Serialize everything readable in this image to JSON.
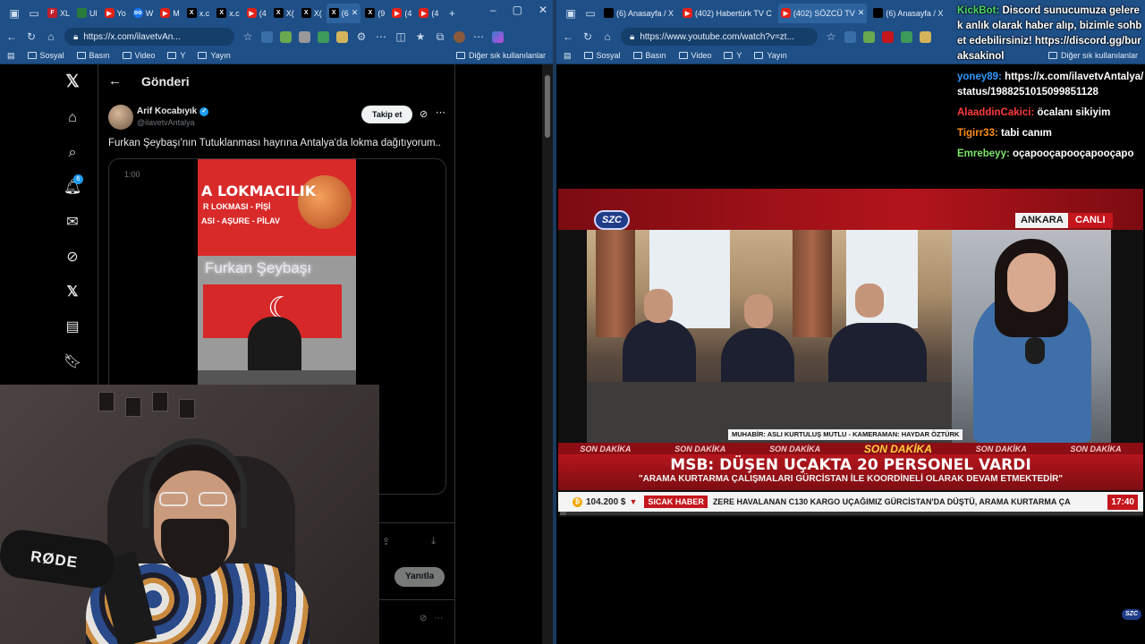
{
  "left_browser": {
    "tabs": [
      {
        "label": "XL",
        "fav": "F",
        "type": "f"
      },
      {
        "label": "Ul",
        "fav": "",
        "type": "g"
      },
      {
        "label": "Yo",
        "fav": "",
        "type": "yt"
      },
      {
        "label": "W",
        "fav": "oo",
        "type": "b"
      },
      {
        "label": "M",
        "fav": "",
        "type": "yt"
      },
      {
        "label": "x.c",
        "fav": "X",
        "type": "x"
      },
      {
        "label": "x.c",
        "fav": "X",
        "type": "x"
      },
      {
        "label": "(4",
        "fav": "",
        "type": "yt"
      },
      {
        "label": "X(",
        "fav": "X",
        "type": "x"
      },
      {
        "label": "X(",
        "fav": "X",
        "type": "x"
      },
      {
        "label": "(6",
        "fav": "X",
        "type": "x",
        "active": true
      },
      {
        "label": "(9",
        "fav": "X",
        "type": "x"
      },
      {
        "label": "(4",
        "fav": "",
        "type": "yt"
      },
      {
        "label": "(4",
        "fav": "",
        "type": "yt"
      }
    ],
    "url": "https://x.com/ilavetvAn...",
    "bookmarks": [
      "Sosyal",
      "Basın",
      "Video",
      "Y",
      "Yayın"
    ],
    "other_bookmarks": "Diğer sık kullanılanlar"
  },
  "x_page": {
    "header_title": "Gönderi",
    "author_name": "Arif Kocabıyık",
    "author_handle": "@ilavetvAntalya",
    "follow_label": "Takip et",
    "tweet_text": "Furkan Şeybaşı'nın Tutuklanması hayrına Antalya'da lokma dağıtıyorum..",
    "video_time": "1:00",
    "sign_line1": "A LOKMACILIK",
    "sign_line2": "R LOKMASI - PİŞİ",
    "sign_line3": "ASI - AŞURE - PİLAV",
    "neon_text": "Furkan Şeybaşı",
    "reply_label": "Yanıtla",
    "notification_count": "6"
  },
  "right_browser": {
    "tabs": [
      {
        "label": "(6) Anasayfa / X",
        "type": "x"
      },
      {
        "label": "(402) Habertürk TV C",
        "type": "yt"
      },
      {
        "label": "(402) SÖZCÜ TV",
        "type": "yt",
        "active": true
      },
      {
        "label": "(6) Anasayfa / X",
        "type": "x"
      }
    ],
    "url": "https://www.youtube.com/watch?v=zt...",
    "bookmarks": [
      "Sosyal",
      "Basın",
      "Video",
      "Y",
      "Yayın"
    ],
    "other_bookmarks": "Diğer sık kullanılanlar"
  },
  "broadcast": {
    "channel_logo": "SZC",
    "location": "ANKARA",
    "live": "CANLI",
    "credit": "MUHABİR: ASLI KURTULUŞ MUTLU - KAMERAMAN: HAYDAR ÖZTÜRK",
    "breaking": "SON DAKİKA",
    "headline": "MSB: DÜŞEN UÇAKTA 20 PERSONEL VARDI",
    "subheadline": "\"ARAMA KURTARMA ÇALIŞMALARI GÜRCİSTAN İLE KOORDİNELİ OLARAK DEVAM ETMEKTEDİR\"",
    "btc_value": "104.200 $",
    "ticker_tag": "SICAK HABER",
    "ticker_text": "ZERE HAVALANAN C130 KARGO UÇAĞIMIZ GÜRCİSTAN'DA DÜŞTÜ, ARAMA KURTARMA ÇA",
    "clock": "17:40",
    "progress_fraction": 0.01
  },
  "chat": [
    {
      "user": "KickBot:",
      "text": "Discord sunucumuza gelerek anlık olarak haber alıp, bizimle sohbet edebilirsiniz! https://discord.gg/buraksakinol",
      "style": "u1"
    },
    {
      "user": "yoney89:",
      "text": "https://x.com/ilavetvAntalya/status/1988251015099851128",
      "style": "u2"
    },
    {
      "user": "AlaaddinCakici:",
      "text": "öcalanı sikiyim",
      "style": "u3"
    },
    {
      "user": "Tigirr33:",
      "text": "tabi canım",
      "style": "u4"
    },
    {
      "user": "Emrebeyy:",
      "text": "oçapooçapooçapooçapo",
      "style": "u5"
    }
  ],
  "webcam": {
    "mic_brand": "RØDE"
  }
}
